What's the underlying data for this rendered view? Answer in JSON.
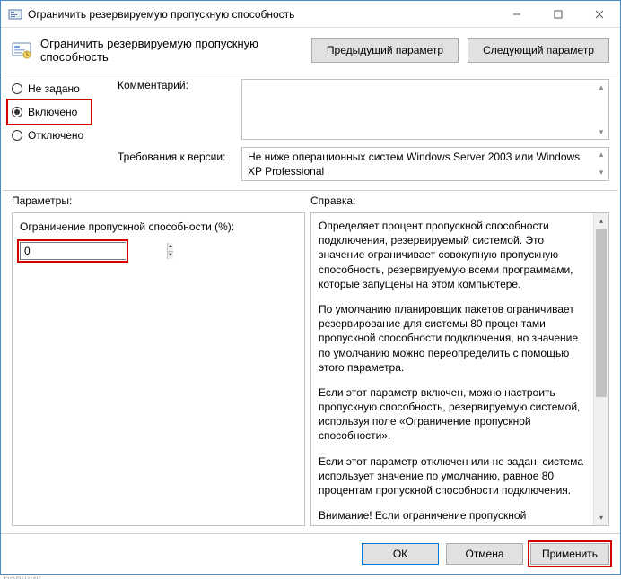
{
  "titlebar": {
    "title": "Ограничить резервируемую пропускную способность"
  },
  "header": {
    "title": "Ограничить резервируемую пропускную способность",
    "prev_btn": "Предыдущий параметр",
    "next_btn": "Следующий параметр"
  },
  "radios": {
    "not_configured": "Не задано",
    "enabled": "Включено",
    "disabled": "Отключено"
  },
  "labels": {
    "comment": "Комментарий:",
    "requirements": "Требования к версии:"
  },
  "requirements_text": "Не ниже операционных систем Windows Server 2003 или Windows XP Professional",
  "section_labels": {
    "parameters": "Параметры:",
    "help": "Справка:"
  },
  "param": {
    "label": "Ограничение пропускной способности (%):",
    "value": "0"
  },
  "help": {
    "p1": "Определяет процент пропускной способности подключения, резервируемый системой. Это значение ограничивает совокупную пропускную способность, резервируемую всеми программами, которые запущены на этом компьютере.",
    "p2": "По умолчанию планировщик пакетов ограничивает резервирование для системы 80 процентами пропускной способности подключения, но значение по умолчанию можно переопределить с помощью этого параметра.",
    "p3": "Если этот параметр включен, можно настроить пропускную способность, резервируемую системой, используя поле «Ограничение пропускной способности».",
    "p4": "Если этот параметр отключен или не задан, система использует значение по умолчанию, равное 80 процентам пропускной способности подключения.",
    "p5": "Внимание! Если ограничение пропускной способности для конкретного сетевого адаптера задано в реестре, этот"
  },
  "footer": {
    "ok": "ОК",
    "cancel": "Отмена",
    "apply": "Применить"
  },
  "cutoff_text": "ровщик"
}
